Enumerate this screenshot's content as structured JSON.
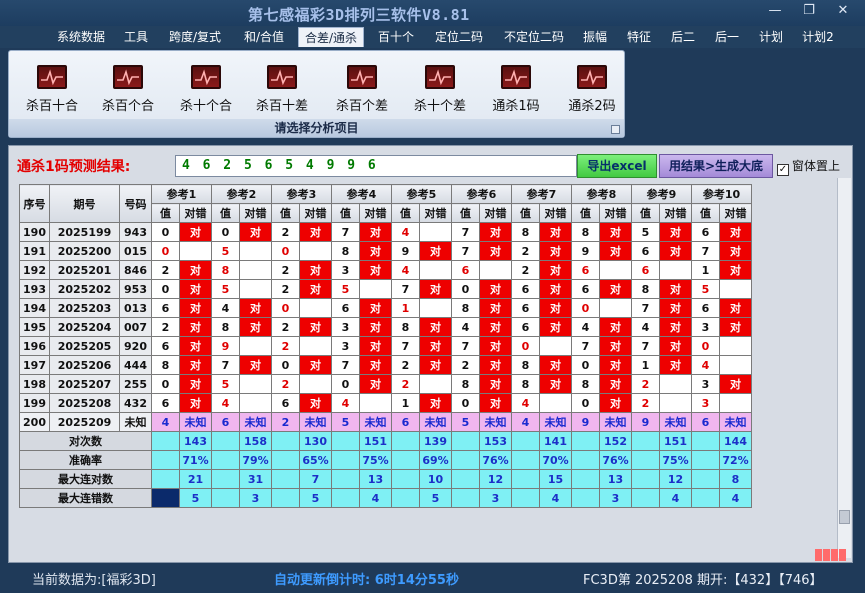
{
  "window": {
    "title": "第七感福彩3D排列三软件V8.81",
    "minimize_glyph": "—",
    "restore_glyph": "❐",
    "close_glyph": "✕"
  },
  "menu": [
    {
      "label": "系统数据",
      "active": false
    },
    {
      "label": "工具",
      "active": false
    },
    {
      "label": "跨度/复式",
      "active": false
    },
    {
      "label": "和/合值",
      "active": false
    },
    {
      "label": "合差/通杀",
      "active": true
    },
    {
      "label": "百十个",
      "active": false
    },
    {
      "label": "定位二码",
      "active": false
    },
    {
      "label": "不定位二码",
      "active": false
    },
    {
      "label": "振幅",
      "active": false
    },
    {
      "label": "特征",
      "active": false
    },
    {
      "label": "后二",
      "active": false
    },
    {
      "label": "后一",
      "active": false
    },
    {
      "label": "计划",
      "active": false
    },
    {
      "label": "计划2",
      "active": false
    }
  ],
  "ribbon": {
    "caption": "请选择分析项目",
    "items": [
      "杀百十合",
      "杀百个合",
      "杀十个合",
      "杀百十差",
      "杀百个差",
      "杀十个差",
      "通杀1码",
      "通杀2码"
    ],
    "icon": "chart-line-icon"
  },
  "panel": {
    "prediction_label": "通杀1码预测结果:",
    "prediction_value": "4 6 2 5 6 5 4 9 9 6",
    "export_button": "导出excel",
    "generate_button": "用结果>生成大底",
    "topmost_label": "窗体置上",
    "topmost_checked": true
  },
  "table": {
    "col_seq": "序号",
    "col_period": "期号",
    "col_number": "号码",
    "col_value": "值",
    "col_result": "对错",
    "ref_headers": [
      "参考1",
      "参考2",
      "参考3",
      "参考4",
      "参考5",
      "参考6",
      "参考7",
      "参考8",
      "参考9",
      "参考10"
    ],
    "hit_text": "对",
    "rows": [
      {
        "seq": "190",
        "period": "2025199",
        "num": "943",
        "v": [
          "0",
          "0",
          "2",
          "7",
          "4",
          "7",
          "8",
          "8",
          "5",
          "6"
        ],
        "h": [
          1,
          1,
          1,
          1,
          0,
          1,
          1,
          1,
          1,
          1
        ],
        "red": [
          0,
          0,
          0,
          0,
          1,
          0,
          0,
          0,
          0,
          0
        ]
      },
      {
        "seq": "191",
        "period": "2025200",
        "num": "015",
        "v": [
          "0",
          "5",
          "0",
          "8",
          "9",
          "7",
          "2",
          "9",
          "6",
          "7"
        ],
        "h": [
          0,
          0,
          0,
          1,
          1,
          1,
          1,
          1,
          1,
          1
        ],
        "red": [
          1,
          1,
          1,
          0,
          0,
          0,
          0,
          0,
          0,
          0
        ]
      },
      {
        "seq": "192",
        "period": "2025201",
        "num": "846",
        "v": [
          "2",
          "8",
          "2",
          "3",
          "4",
          "6",
          "2",
          "6",
          "6",
          "1"
        ],
        "h": [
          1,
          0,
          1,
          1,
          0,
          0,
          1,
          0,
          0,
          1
        ],
        "red": [
          0,
          1,
          0,
          0,
          1,
          1,
          0,
          1,
          1,
          0
        ]
      },
      {
        "seq": "193",
        "period": "2025202",
        "num": "953",
        "v": [
          "0",
          "5",
          "2",
          "5",
          "7",
          "0",
          "6",
          "6",
          "8",
          "5"
        ],
        "h": [
          1,
          0,
          1,
          0,
          1,
          1,
          1,
          1,
          1,
          0
        ],
        "red": [
          0,
          1,
          0,
          1,
          0,
          0,
          0,
          0,
          0,
          1
        ]
      },
      {
        "seq": "194",
        "period": "2025203",
        "num": "013",
        "v": [
          "6",
          "4",
          "0",
          "6",
          "1",
          "8",
          "6",
          "0",
          "7",
          "6"
        ],
        "h": [
          1,
          1,
          0,
          1,
          0,
          1,
          1,
          0,
          1,
          1
        ],
        "red": [
          0,
          0,
          1,
          0,
          1,
          0,
          0,
          1,
          0,
          0
        ]
      },
      {
        "seq": "195",
        "period": "2025204",
        "num": "007",
        "v": [
          "2",
          "8",
          "2",
          "3",
          "8",
          "4",
          "6",
          "4",
          "4",
          "3"
        ],
        "h": [
          1,
          1,
          1,
          1,
          1,
          1,
          1,
          1,
          1,
          1
        ],
        "red": [
          0,
          0,
          0,
          0,
          0,
          0,
          0,
          0,
          0,
          0
        ]
      },
      {
        "seq": "196",
        "period": "2025205",
        "num": "920",
        "v": [
          "6",
          "9",
          "2",
          "3",
          "7",
          "7",
          "0",
          "7",
          "7",
          "0"
        ],
        "h": [
          1,
          0,
          0,
          1,
          1,
          1,
          0,
          1,
          1,
          0
        ],
        "red": [
          0,
          1,
          1,
          0,
          0,
          0,
          1,
          0,
          0,
          1
        ]
      },
      {
        "seq": "197",
        "period": "2025206",
        "num": "444",
        "v": [
          "8",
          "7",
          "0",
          "7",
          "2",
          "2",
          "8",
          "0",
          "1",
          "4"
        ],
        "h": [
          1,
          1,
          1,
          1,
          1,
          1,
          1,
          1,
          1,
          0
        ],
        "red": [
          0,
          0,
          0,
          0,
          0,
          0,
          0,
          0,
          0,
          1
        ]
      },
      {
        "seq": "198",
        "period": "2025207",
        "num": "255",
        "v": [
          "0",
          "5",
          "2",
          "0",
          "2",
          "8",
          "8",
          "8",
          "2",
          "3"
        ],
        "h": [
          1,
          0,
          0,
          1,
          0,
          1,
          1,
          1,
          0,
          1
        ],
        "red": [
          0,
          1,
          1,
          0,
          1,
          0,
          0,
          0,
          1,
          0
        ]
      },
      {
        "seq": "199",
        "period": "2025208",
        "num": "432",
        "v": [
          "6",
          "4",
          "6",
          "4",
          "1",
          "0",
          "4",
          "0",
          "2",
          "3"
        ],
        "h": [
          1,
          0,
          1,
          0,
          1,
          1,
          0,
          1,
          0,
          0
        ],
        "red": [
          0,
          1,
          0,
          1,
          0,
          0,
          1,
          0,
          1,
          1
        ]
      }
    ],
    "prediction_row": {
      "seq": "200",
      "period": "2025209",
      "num": "未知",
      "v": [
        "4",
        "6",
        "2",
        "5",
        "6",
        "5",
        "4",
        "9",
        "9",
        "6"
      ],
      "unknown": "未知"
    },
    "stats": [
      {
        "label": "对次数",
        "values": [
          "143",
          "158",
          "130",
          "151",
          "139",
          "153",
          "141",
          "152",
          "151",
          "144"
        ]
      },
      {
        "label": "准确率",
        "values": [
          "71%",
          "79%",
          "65%",
          "75%",
          "69%",
          "76%",
          "70%",
          "76%",
          "75%",
          "72%"
        ]
      },
      {
        "label": "最大连对数",
        "values": [
          "21",
          "31",
          "7",
          "13",
          "10",
          "12",
          "15",
          "13",
          "12",
          "8"
        ]
      },
      {
        "label": "最大连错数",
        "values": [
          "5",
          "3",
          "5",
          "4",
          "5",
          "3",
          "4",
          "3",
          "4",
          "4"
        ]
      }
    ]
  },
  "status": {
    "current_data": "当前数据为:[福彩3D]",
    "countdown": "自动更新倒计时: 6时14分55秒",
    "last_draw": "FC3D第 2025208 期开:【432】【746】"
  },
  "colors": {
    "hit": "#ee0000",
    "prediction_row": "#f0b6ef",
    "stats": "#7ff0f4",
    "title": "#a7c0ea",
    "countdown": "#3e9bff"
  }
}
